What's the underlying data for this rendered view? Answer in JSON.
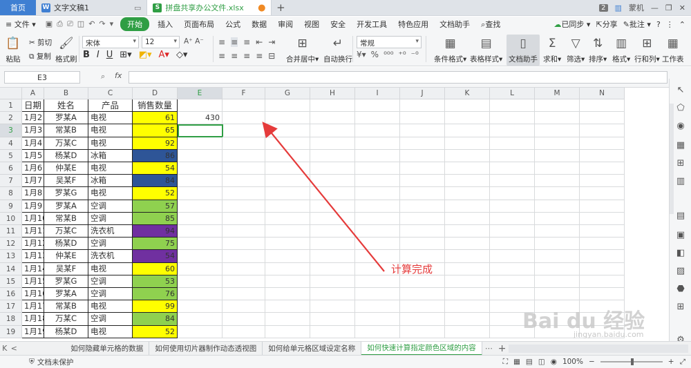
{
  "titlebar": {
    "home_tab": "首页",
    "tabs": [
      {
        "label": "文字文稿1",
        "icon": "W",
        "color": "#3f7fd2"
      },
      {
        "label": "拼盘共享办公文件.xlsx",
        "icon": "S",
        "color": "#2f9e44"
      }
    ],
    "page_count": "2",
    "user": "蒙机"
  },
  "menubar": {
    "file": "文件",
    "items": [
      "开始",
      "插入",
      "页面布局",
      "公式",
      "数据",
      "审阅",
      "视图",
      "安全",
      "开发工具",
      "特色应用",
      "文档助手"
    ],
    "search": "查找",
    "sync": "已同步",
    "share": "分享",
    "comment": "批注"
  },
  "ribbon": {
    "paste": "粘贴",
    "cut": "剪切",
    "copy": "复制",
    "format_painter": "格式刷",
    "font_name": "宋体",
    "font_size": "12",
    "merge": "合并居中",
    "wrap": "自动换行",
    "number_format": "常规",
    "cond_format": "条件格式",
    "table_style": "表格样式",
    "doc_assist": "文档助手",
    "sum": "求和",
    "filter": "筛选",
    "sort": "排序",
    "format": "格式",
    "rowcol": "行和列",
    "worksheet": "工作表"
  },
  "formulabar": {
    "namebox": "E3",
    "fx": "fx"
  },
  "grid": {
    "columns": [
      "A",
      "B",
      "C",
      "D",
      "E",
      "F",
      "G",
      "H",
      "I",
      "J",
      "K",
      "L",
      "M",
      "N"
    ],
    "header_row": [
      "日期",
      "姓名",
      "产品",
      "销售数量"
    ],
    "rows": [
      [
        "1月2日",
        "罗某A",
        "电视",
        "61"
      ],
      [
        "1月3日",
        "常某B",
        "电视",
        "65"
      ],
      [
        "1月4日",
        "万某C",
        "电视",
        "92"
      ],
      [
        "1月5日",
        "杨某D",
        "冰箱",
        "86"
      ],
      [
        "1月6日",
        "仲某E",
        "电视",
        "54"
      ],
      [
        "1月7日",
        "吴某F",
        "冰箱",
        "84"
      ],
      [
        "1月8日",
        "罗某G",
        "电视",
        "52"
      ],
      [
        "1月9日",
        "罗某A",
        "空调",
        "57"
      ],
      [
        "1月10日",
        "常某B",
        "空调",
        "85"
      ],
      [
        "1月11日",
        "万某C",
        "洗衣机",
        "94"
      ],
      [
        "1月12日",
        "杨某D",
        "空调",
        "75"
      ],
      [
        "1月13日",
        "仲某E",
        "洗衣机",
        "54"
      ],
      [
        "1月14日",
        "吴某F",
        "电视",
        "60"
      ],
      [
        "1月15日",
        "罗某G",
        "空调",
        "53"
      ],
      [
        "1月16日",
        "罗某A",
        "空调",
        "76"
      ],
      [
        "1月17日",
        "常某B",
        "电视",
        "99"
      ],
      [
        "1月18日",
        "万某C",
        "空调",
        "84"
      ],
      [
        "1月19日",
        "杨某D",
        "电视",
        "52"
      ]
    ],
    "d_colors": [
      "#ffff00",
      "#ffff00",
      "#ffff00",
      "#2e5597",
      "#ffff00",
      "#2e5597",
      "#ffff00",
      "#8fd14f",
      "#8fd14f",
      "#7030a0",
      "#8fd14f",
      "#7030a0",
      "#ffff00",
      "#8fd14f",
      "#8fd14f",
      "#ffff00",
      "#8fd14f",
      "#ffff00"
    ],
    "e2_value": "430"
  },
  "annotation": "计算完成",
  "watermark": "Bai du 经验",
  "watermark_url": "jingyan.baidu.com",
  "sheets": [
    "如何隐藏单元格的数据",
    "如何使用切片器制作动态透视图",
    "如何给单元格区域设定名称",
    "如何快速计算指定颜色区域的内容"
  ],
  "statusbar": {
    "protect": "文档未保护",
    "zoom": "100%"
  }
}
